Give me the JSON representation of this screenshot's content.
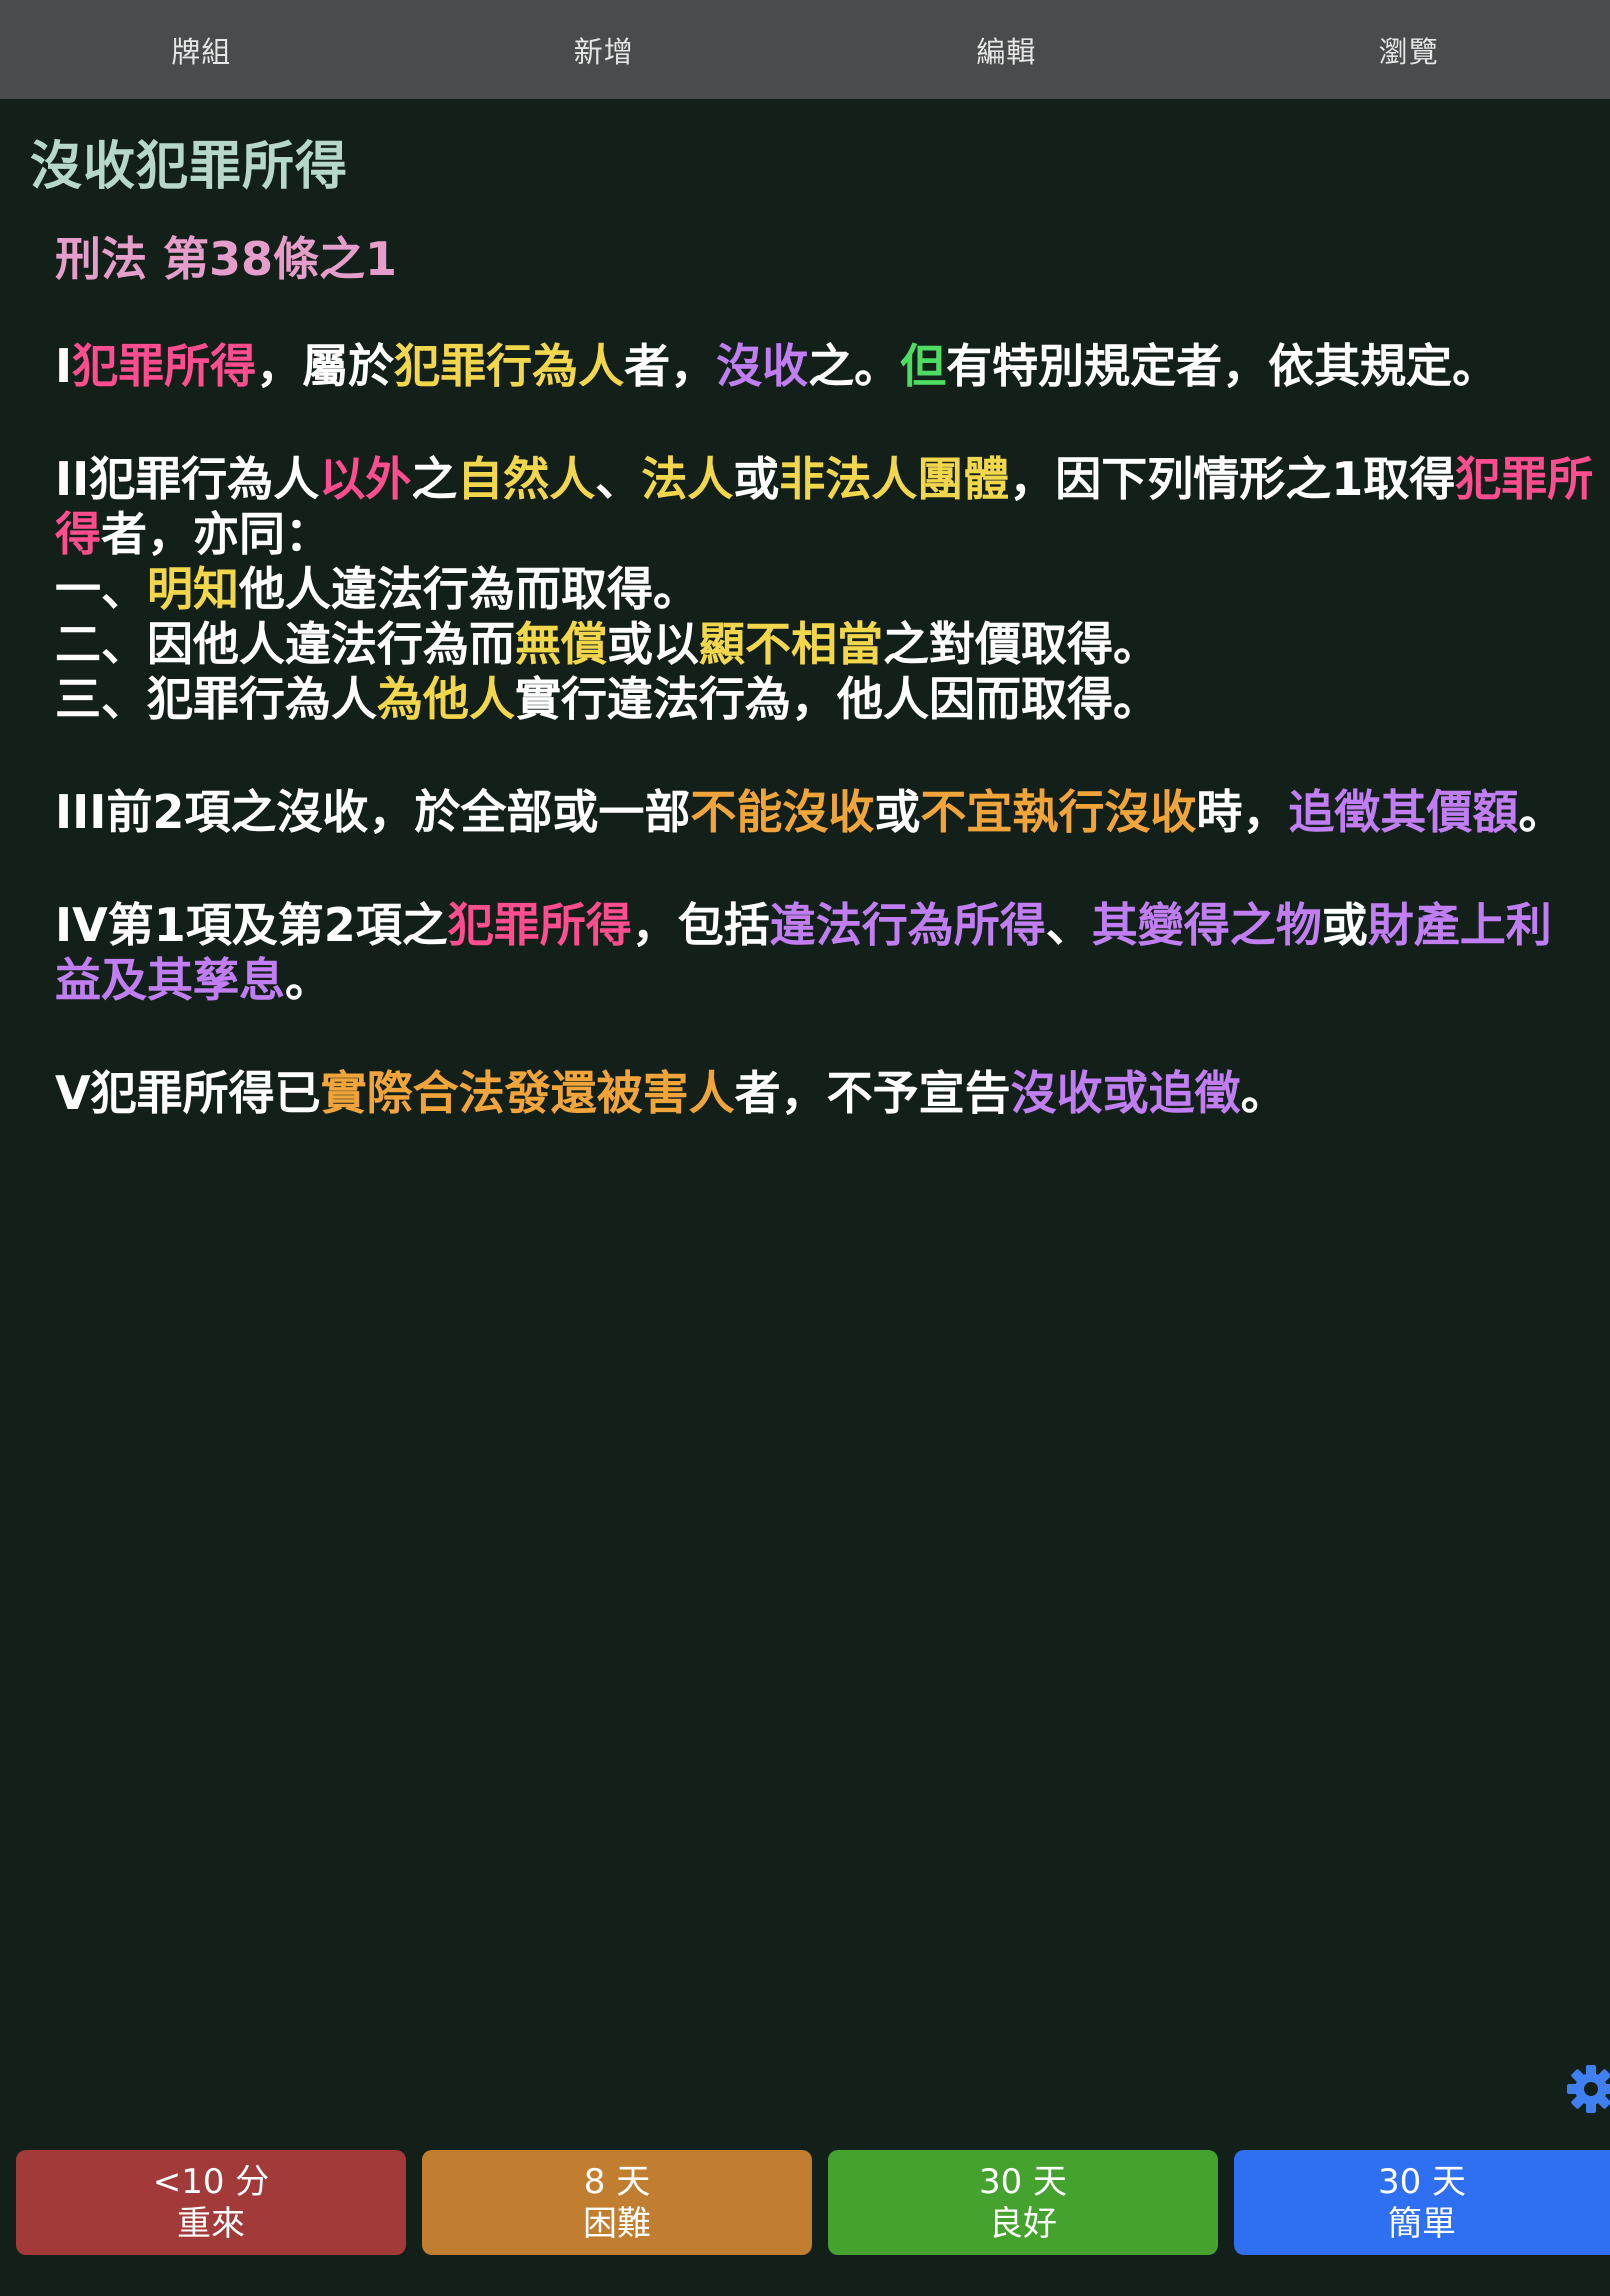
{
  "top_nav": {
    "tabs": [
      {
        "label": "牌組"
      },
      {
        "label": "新增"
      },
      {
        "label": "編輯"
      },
      {
        "label": "瀏覽"
      }
    ]
  },
  "deck": {
    "title": "沒收犯罪所得"
  },
  "card": {
    "heading": "刑法 第38條之1",
    "p1": {
      "s1": "I",
      "s2": "犯罪所得",
      "s3": "，屬於",
      "s4": "犯罪行為人",
      "s5": "者，",
      "s6": "沒收",
      "s7": "之。",
      "s8": "但",
      "s9": "有特別規定者，依其規定。"
    },
    "p2": {
      "s1": "II犯罪行為人",
      "s2": "以外",
      "s3": "之",
      "s4": "自然人",
      "s5": "、",
      "s6": "法人",
      "s7": "或",
      "s8": "非法人團體",
      "s9": "，因下列情形之1取得",
      "s10": "犯罪所得",
      "s11": "者，亦同："
    },
    "p2_items": {
      "i1a": "一、",
      "i1b": "明知",
      "i1c": "他人違法行為而取得。",
      "i2a": "二、因他人違法行為而",
      "i2b": "無償",
      "i2c": "或以",
      "i2d": "顯不相當",
      "i2e": "之對價取得。",
      "i3a": "三、犯罪行為人",
      "i3b": "為他人",
      "i3c": "實行違法行為，他人因而取得。"
    },
    "p3": {
      "s1": "III前2項之沒收，於全部或一部",
      "s2": "不能沒收",
      "s3": "或",
      "s4": "不宜執行沒收",
      "s5": "時，",
      "s6": "追徵其價額",
      "s7": "。"
    },
    "p4": {
      "s1": "IV第1項及第2項之",
      "s2": "犯罪所得",
      "s3": "，包括",
      "s4": "違法行為所得",
      "s5": "、",
      "s6": "其變得之物",
      "s7": "或",
      "s8": "財產上利益及其孳息",
      "s9": "。"
    },
    "p5": {
      "s1": "V犯罪所得已",
      "s2": "實際合法發還被害人",
      "s3": "者，不予宣告",
      "s4": "沒收或追徵",
      "s5": "。"
    }
  },
  "answer_buttons": [
    {
      "interval": "<10 分",
      "label": "重來",
      "color": "#a23a3a"
    },
    {
      "interval": "8 天",
      "label": "困難",
      "color": "#c27e30"
    },
    {
      "interval": "30 天",
      "label": "良好",
      "color": "#45a22f"
    },
    {
      "interval": "30 天",
      "label": "簡單",
      "color": "#2f6ff2"
    }
  ],
  "icons": {
    "settings": "gear-icon"
  },
  "colors": {
    "background": "#13201a",
    "topbar": "#4a4b4c",
    "deck_title": "#b7d7cb",
    "heading": "#e59dc9",
    "highlight_pink": "#ff4d8f",
    "highlight_yellow": "#f2d64b",
    "highlight_purple": "#c07ef2",
    "highlight_green": "#4fdc62",
    "highlight_orange": "#f0a43a"
  }
}
